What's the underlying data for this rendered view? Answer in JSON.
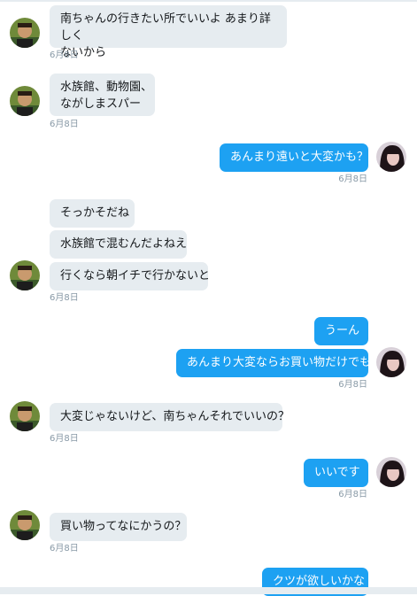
{
  "messages": [
    {
      "side": "in",
      "text": "南ちゃんの行きたい所でいいよ あまり詳しくないから"
    },
    {
      "side": "in",
      "time": "6月8日"
    },
    {
      "side": "in",
      "text": "水族館、動物園、ながしまスパー"
    },
    {
      "side": "in",
      "time": "6月8日"
    },
    {
      "side": "out",
      "text": "あんまり遠いと大変かも？",
      "time": "6月8日"
    },
    {
      "side": "in",
      "text": "そっかそだね"
    },
    {
      "side": "in",
      "text": "水族館で混むんだよねえ"
    },
    {
      "side": "in",
      "text": "行くなら朝イチで行かないと",
      "time": "6月8日"
    },
    {
      "side": "out",
      "text": "うーん"
    },
    {
      "side": "out",
      "text": "あんまり大変ならお買い物だけでも",
      "time": "6月8日"
    },
    {
      "side": "in",
      "text": "大変じゃないけど、南ちゃんそれでいいの？",
      "time": "6月8日"
    },
    {
      "side": "out",
      "text": "いいです",
      "time": "6月8日"
    },
    {
      "side": "in",
      "text": "買い物ってなにかうの？",
      "time": "6月8日"
    },
    {
      "side": "out",
      "text": "クツが欲しいかな"
    }
  ],
  "m1": {
    "line1": "南ちゃんの行きたい所でいいよ あまり詳しく",
    "line2": "ないから",
    "time": "6月8日"
  },
  "m2": {
    "line1": "水族館、動物園、",
    "line2": "ながしまスパー",
    "time": "6月8日"
  },
  "m3": {
    "text": "あんまり遠いと大変かも？",
    "time": "6月8日"
  },
  "m4": {
    "text": "そっかそだね"
  },
  "m5": {
    "text": "水族館で混むんだよねえ"
  },
  "m6": {
    "text": "行くなら朝イチで行かないと",
    "time": "6月8日"
  },
  "m7": {
    "text": "うーん"
  },
  "m8": {
    "text": "あんまり大変ならお買い物だけでも",
    "time": "6月8日"
  },
  "m9": {
    "text": "大変じゃないけど、南ちゃんそれでいいの？",
    "time": "6月8日"
  },
  "m10": {
    "text": "いいです",
    "time": "6月8日"
  },
  "m11": {
    "text": "買い物ってなにかうの？",
    "time": "6月8日"
  },
  "m12": {
    "text": "クツが欲しいかな"
  },
  "colors": {
    "incoming_bubble": "#e6ecf0",
    "outgoing_bubble": "#1da1f2",
    "timestamp": "#8899a6"
  },
  "icons": {
    "partner_avatar": "man-photo-avatar",
    "self_avatar": "woman-photo-avatar"
  }
}
